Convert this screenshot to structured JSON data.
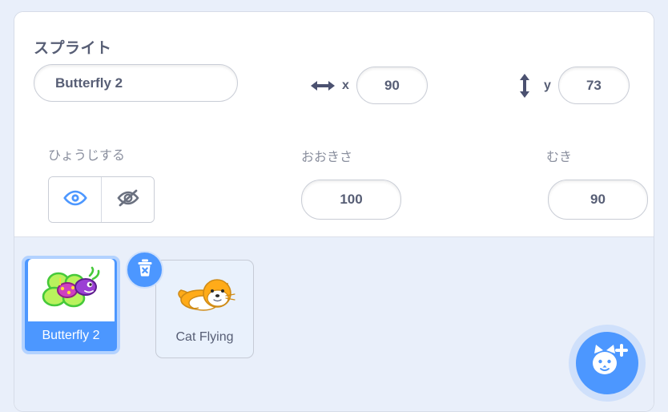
{
  "panel": {
    "section_title": "スプライト",
    "sprite_name": {
      "value": "Butterfly 2",
      "placeholder": "Sprite"
    },
    "x": {
      "letter": "x",
      "value": "90",
      "icon": "arrows-horizontal-icon"
    },
    "y": {
      "letter": "y",
      "value": "73",
      "icon": "arrows-vertical-icon"
    },
    "show": {
      "label": "ひょうじする",
      "show_icon": "eye-icon",
      "hide_icon": "eye-slash-icon",
      "active": "show"
    },
    "size": {
      "label": "おおきさ",
      "value": "100"
    },
    "direction": {
      "label": "むき",
      "value": "90"
    }
  },
  "sprite_list": {
    "sprites": [
      {
        "name": "Butterfly 2",
        "selected": true,
        "thumb": "butterfly-thumb"
      },
      {
        "name": "Cat Flying",
        "selected": false,
        "thumb": "cat-thumb"
      }
    ],
    "delete_badge_icon": "trash-delete-icon",
    "add_sprite_icon": "cat-plus-icon"
  },
  "colors": {
    "accent": "#4c97ff",
    "accent_light": "#cfe0fb",
    "text": "#575e75",
    "muted_text": "#8a8f9e",
    "page_bg": "#e9effa"
  }
}
